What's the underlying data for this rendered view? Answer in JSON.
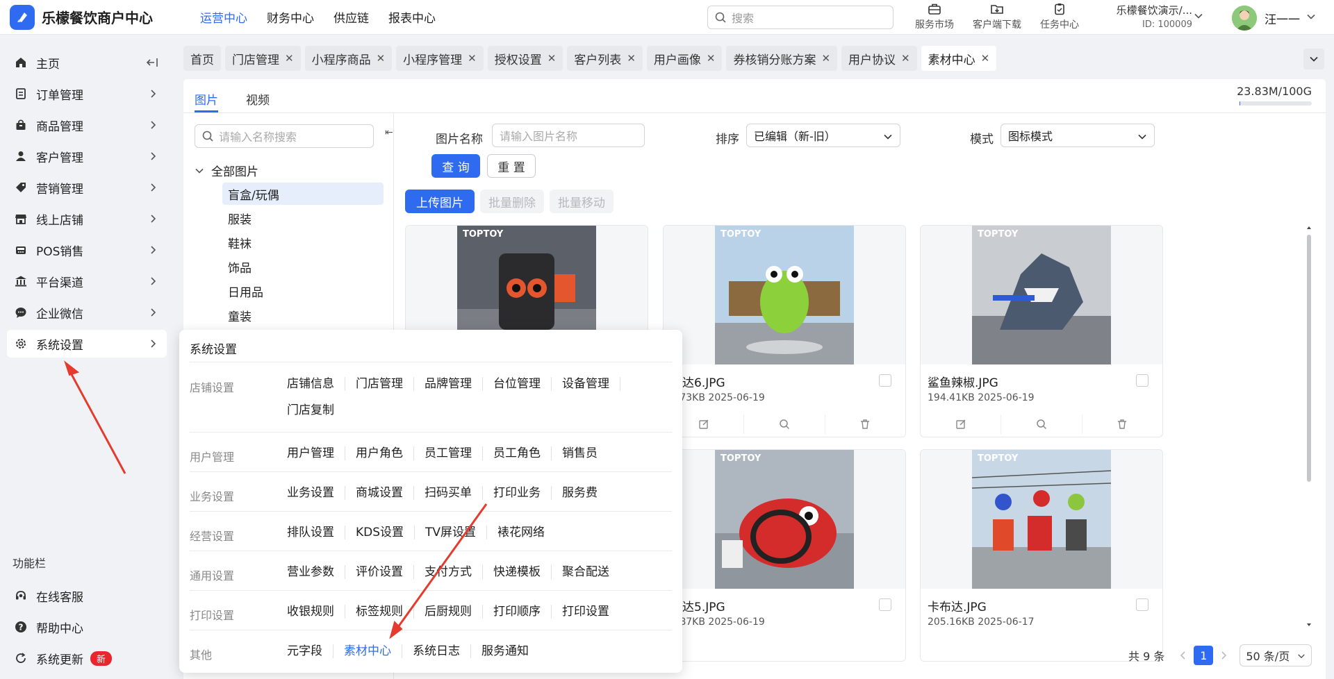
{
  "app": {
    "title": "乐檬餐饮商户中心",
    "top_nav": [
      "运营中心",
      "财务中心",
      "供应链",
      "报表中心"
    ],
    "search_placeholder": "搜索",
    "tools": [
      {
        "label": "服务市场",
        "icon": "briefcase-icon"
      },
      {
        "label": "客户端下载",
        "icon": "folder-download-icon"
      },
      {
        "label": "任务中心",
        "icon": "clipboard-icon"
      }
    ],
    "org_name": "乐檬餐饮演示/...",
    "org_id": "ID: 100009",
    "user_name": "汪一一"
  },
  "sidebar": {
    "items": [
      {
        "label": "主页",
        "icon": "home-icon"
      },
      {
        "label": "订单管理",
        "icon": "order-icon"
      },
      {
        "label": "商品管理",
        "icon": "bag-icon"
      },
      {
        "label": "客户管理",
        "icon": "user-icon"
      },
      {
        "label": "营销管理",
        "icon": "tag-icon"
      },
      {
        "label": "线上店铺",
        "icon": "shop-icon"
      },
      {
        "label": "POS销售",
        "icon": "pos-icon"
      },
      {
        "label": "平台渠道",
        "icon": "bank-icon"
      },
      {
        "label": "企业微信",
        "icon": "chat-icon"
      },
      {
        "label": "系统设置",
        "icon": "gear-icon"
      }
    ],
    "section_label": "功能栏",
    "footer_items": [
      {
        "label": "在线客服",
        "icon": "headset-icon"
      },
      {
        "label": "帮助中心",
        "icon": "help-icon"
      },
      {
        "label": "系统更新",
        "icon": "refresh-icon",
        "badge": "新"
      }
    ]
  },
  "tabs": [
    "首页",
    "门店管理",
    "小程序商品",
    "小程序管理",
    "授权设置",
    "客户列表",
    "用户画像",
    "券核销分账方案",
    "用户协议",
    "素材中心"
  ],
  "main": {
    "subtabs": [
      "图片",
      "视频"
    ],
    "storage": "23.83M/100G",
    "storage_used_fraction": 0.0002,
    "category_search_placeholder": "请输入名称搜索",
    "category_root": "全部图片",
    "categories": [
      "盲盒/玩偶",
      "服装",
      "鞋袜",
      "饰品",
      "日用品",
      "童装"
    ],
    "filters": {
      "name_label": "图片名称",
      "name_placeholder": "请输入图片名称",
      "sort_label": "排序",
      "sort_value": "已编辑（新-旧）",
      "mode_label": "模式",
      "mode_value": "图标模式"
    },
    "buttons": {
      "query": "查 询",
      "reset": "重 置",
      "upload": "上传图片",
      "batch_delete": "批量删除",
      "batch_move": "批量移动"
    },
    "thumb_brand": "TOPTOY",
    "images": [
      {
        "name": "",
        "meta": ""
      },
      {
        "name": "布达6.JPG",
        "meta": "3.73KB 2025-06-19"
      },
      {
        "name": "鲨鱼辣椒.JPG",
        "meta": "194.41KB 2025-06-19"
      },
      {
        "name": "",
        "meta": ""
      },
      {
        "name": "布达5.JPG",
        "meta": "0.87KB 2025-06-19"
      },
      {
        "name": "卡布达.JPG",
        "meta": "205.16KB 2025-06-17"
      }
    ],
    "pagination": {
      "total": "共 9 条",
      "current": "1",
      "page_size": "50 条/页"
    }
  },
  "flyout": {
    "title": "系统设置",
    "groups": [
      {
        "name": "店铺设置",
        "links": [
          "店铺信息",
          "门店管理",
          "品牌管理",
          "台位管理",
          "设备管理",
          "门店复制"
        ]
      },
      {
        "name": "用户管理",
        "links": [
          "用户管理",
          "用户角色",
          "员工管理",
          "员工角色",
          "销售员"
        ]
      },
      {
        "name": "业务设置",
        "links": [
          "业务设置",
          "商城设置",
          "扫码买单",
          "打印业务",
          "服务费"
        ]
      },
      {
        "name": "经营设置",
        "links": [
          "排队设置",
          "KDS设置",
          "TV屏设置",
          "裱花网络"
        ]
      },
      {
        "name": "通用设置",
        "links": [
          "营业参数",
          "评价设置",
          "支付方式",
          "快递模板",
          "聚合配送"
        ]
      },
      {
        "name": "打印设置",
        "links": [
          "收银规则",
          "标签规则",
          "后厨规则",
          "打印顺序",
          "打印设置"
        ]
      },
      {
        "name": "其他",
        "links": [
          "元字段",
          "素材中心",
          "系统日志",
          "服务通知"
        ]
      }
    ],
    "highlighted_link": "素材中心"
  },
  "colors": {
    "accent": "#2f6bf0",
    "annotation_arrow": "#e53a2e",
    "badge": "#e8262d"
  }
}
